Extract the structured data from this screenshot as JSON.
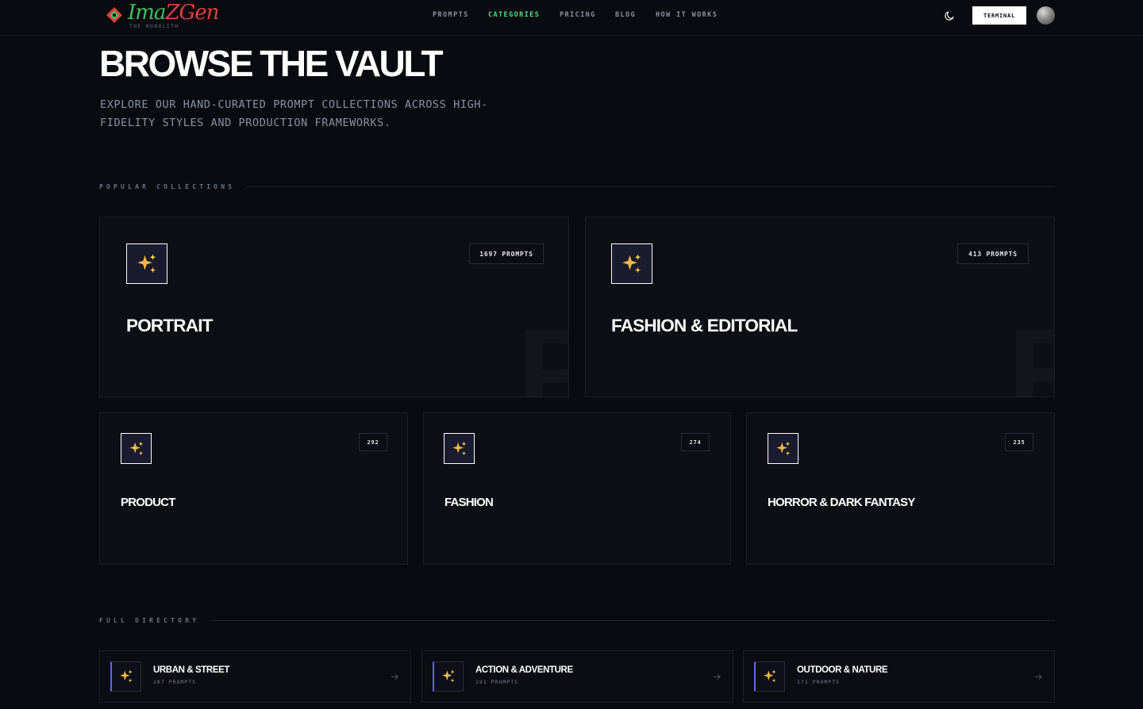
{
  "brand": {
    "name_part1": "Ima",
    "name_part2": "ZGen",
    "tagline": "THE MONOLITH"
  },
  "nav": {
    "items": [
      {
        "label": "PROMPTS",
        "active": false
      },
      {
        "label": "CATEGORIES",
        "active": true
      },
      {
        "label": "PRICING",
        "active": false
      },
      {
        "label": "BLOG",
        "active": false
      },
      {
        "label": "HOW IT WORKS",
        "active": false
      }
    ],
    "terminal_label": "TERMINAL",
    "theme_icon": "moon-icon",
    "avatar": "user-avatar"
  },
  "hero": {
    "title": "BROWSE THE VAULT",
    "subtitle": "EXPLORE OUR HAND-CURATED PROMPT COLLECTIONS ACROSS HIGH-FIDELITY STYLES AND PRODUCTION FRAMEWORKS."
  },
  "popular": {
    "label": "POPULAR COLLECTIONS",
    "featured": [
      {
        "title": "PORTRAIT",
        "count": "1697 PROMPTS",
        "letter": "P",
        "icon": "sparkles-icon"
      },
      {
        "title": "FASHION & EDITORIAL",
        "count": "413 PROMPTS",
        "letter": "F",
        "icon": "sparkles-icon"
      }
    ],
    "small": [
      {
        "title": "PRODUCT",
        "count": "292",
        "icon": "sparkles-icon"
      },
      {
        "title": "FASHION",
        "count": "274",
        "icon": "sparkles-icon"
      },
      {
        "title": "HORROR & DARK FANTASY",
        "count": "235",
        "icon": "sparkles-icon"
      }
    ]
  },
  "directory": {
    "label": "FULL DIRECTORY",
    "items": [
      {
        "title": "URBAN & STREET",
        "count": "207 PROMPTS",
        "icon": "sparkles-icon"
      },
      {
        "title": "ACTION & ADVENTURE",
        "count": "191 PROMPTS",
        "icon": "sparkles-icon"
      },
      {
        "title": "OUTDOOR & NATURE",
        "count": "171 PROMPTS",
        "icon": "sparkles-icon"
      }
    ]
  },
  "colors": {
    "background": "#0a0b10",
    "accent_green": "#4ade80",
    "accent_indigo": "#6366f1",
    "sparkle": "#f5b942"
  }
}
